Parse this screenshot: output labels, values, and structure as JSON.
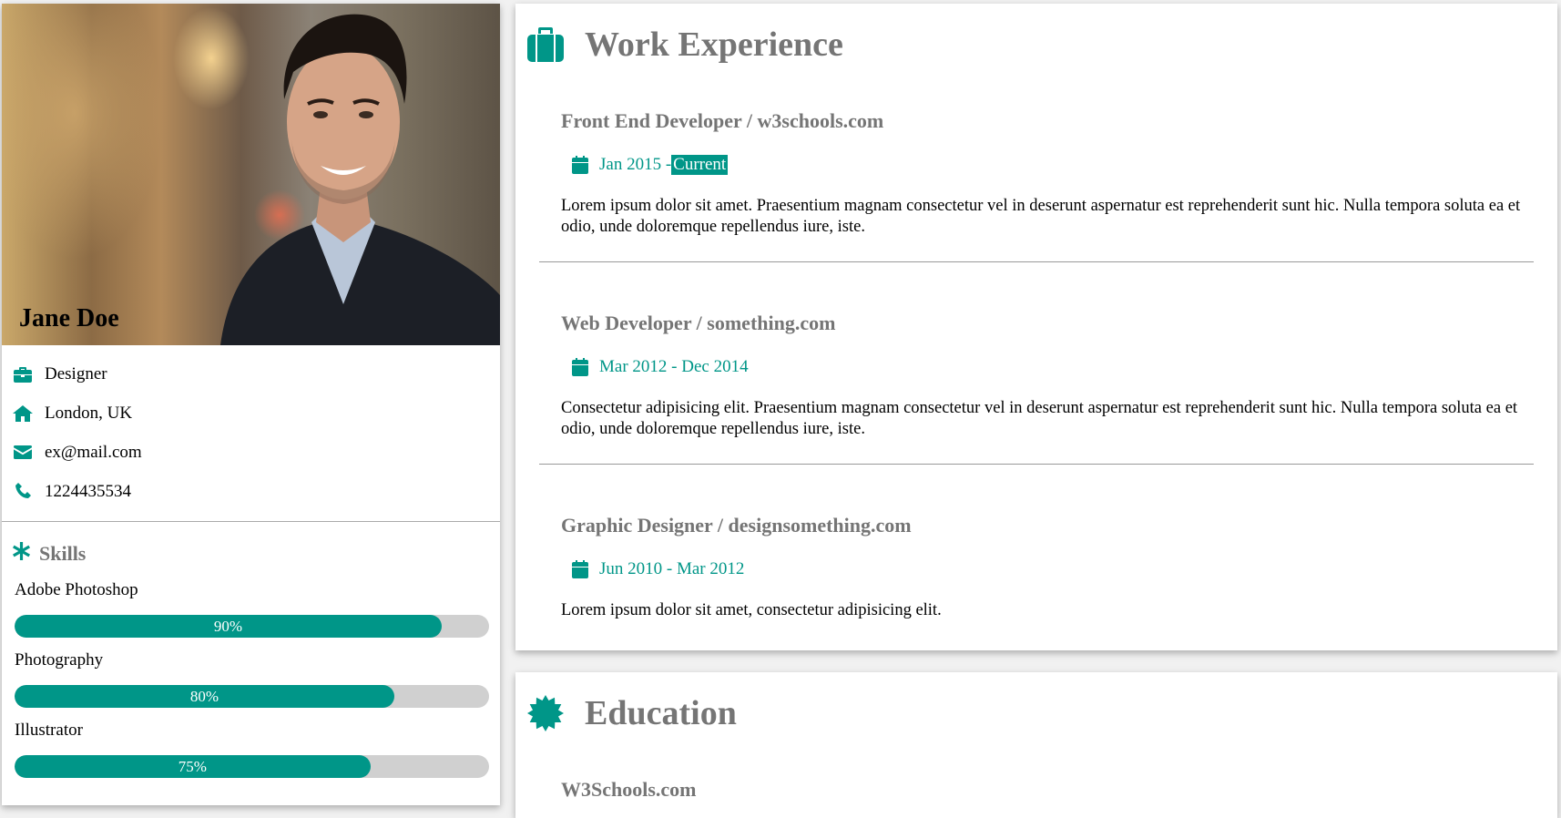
{
  "profile": {
    "name": "Jane Doe",
    "info": [
      {
        "icon": "briefcase-icon",
        "text": "Designer"
      },
      {
        "icon": "home-icon",
        "text": "London, UK"
      },
      {
        "icon": "envelope-icon",
        "text": "ex@mail.com"
      },
      {
        "icon": "phone-icon",
        "text": "1224435534"
      }
    ]
  },
  "skills": {
    "title": "Skills",
    "items": [
      {
        "name": "Adobe Photoshop",
        "percent": 90,
        "label": "90%"
      },
      {
        "name": "Photography",
        "percent": 80,
        "label": "80%"
      },
      {
        "name": "Illustrator",
        "percent": 75,
        "label": "75%"
      }
    ]
  },
  "work": {
    "title": "Work Experience",
    "jobs": [
      {
        "title": "Front End Developer / w3schools.com",
        "date_start": "Jan 2015 - ",
        "date_end": "Current",
        "current": true,
        "description": "Lorem ipsum dolor sit amet. Praesentium magnam consectetur vel in deserunt aspernatur est reprehenderit sunt hic. Nulla tempora soluta ea et odio, unde doloremque repellendus iure, iste."
      },
      {
        "title": "Web Developer / something.com",
        "date_start": "Mar 2012 - Dec 2014",
        "date_end": "",
        "current": false,
        "description": "Consectetur adipisicing elit. Praesentium magnam consectetur vel in deserunt aspernatur est reprehenderit sunt hic. Nulla tempora soluta ea et odio, unde doloremque repellendus iure, iste."
      },
      {
        "title": "Graphic Designer / designsomething.com",
        "date_start": "Jun 2010 - Mar 2012",
        "date_end": "",
        "current": false,
        "description": "Lorem ipsum dolor sit amet, consectetur adipisicing elit."
      }
    ]
  },
  "education": {
    "title": "Education",
    "items": [
      {
        "school": "W3Schools.com"
      }
    ]
  },
  "colors": {
    "accent": "#009688",
    "heading_gray": "#757575",
    "bar_track": "#d0d0d0"
  }
}
